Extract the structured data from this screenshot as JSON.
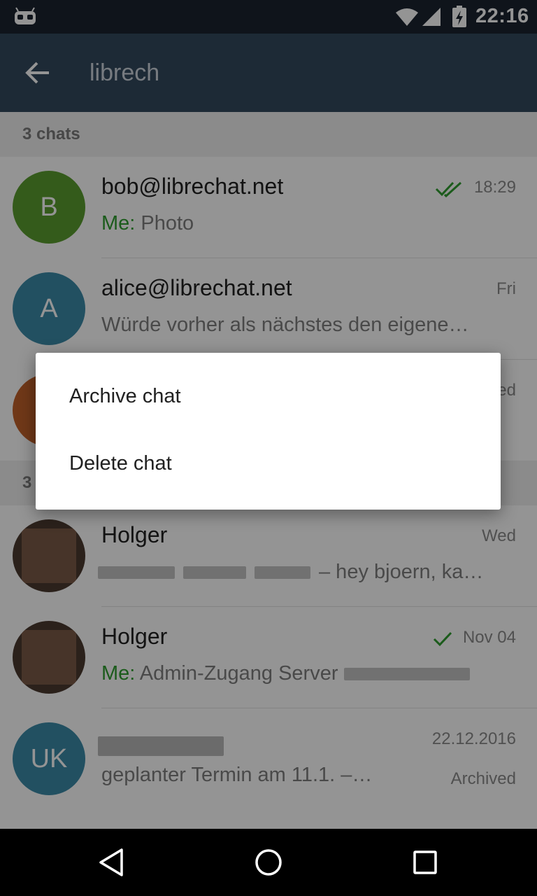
{
  "status_bar": {
    "time": "22:16"
  },
  "toolbar": {
    "search_value": "librech"
  },
  "sections": [
    {
      "header": "3 chats"
    },
    {
      "header": "3"
    }
  ],
  "chats": [
    {
      "avatar_letter": "B",
      "avatar_color": "#5b9e2f",
      "name": "bob@librechat.net",
      "date": "18:29",
      "status": "read",
      "me_prefix": "Me:",
      "summary": " Photo"
    },
    {
      "avatar_letter": "A",
      "avatar_color": "#3c8aa8",
      "name": "alice@librechat.net",
      "date": "Fri",
      "summary": "Würde vorher als nächstes den eigene…"
    },
    {
      "avatar_letter": "",
      "avatar_color": "#c2612a",
      "name": "",
      "date": "ed",
      "summary": ""
    }
  ],
  "messages": [
    {
      "name": "Holger",
      "date": "Wed",
      "summary": "– hey bjoern, ka…"
    },
    {
      "name": "Holger",
      "date": "Nov 04",
      "status": "sent",
      "me_prefix": "Me:",
      "summary": " Admin-Zugang Server"
    },
    {
      "avatar_letter": "UK",
      "avatar_color": "#3c8aa8",
      "date": "22.12.2016",
      "summary": "geplanter Termin am 11.1. –…",
      "badge": "Archived"
    }
  ],
  "dialog": {
    "items": [
      {
        "label": "Archive chat"
      },
      {
        "label": "Delete chat"
      }
    ]
  },
  "colors": {
    "status_bar": "#1a2430",
    "toolbar": "#33495e",
    "accent_green": "#2f9e2f"
  }
}
